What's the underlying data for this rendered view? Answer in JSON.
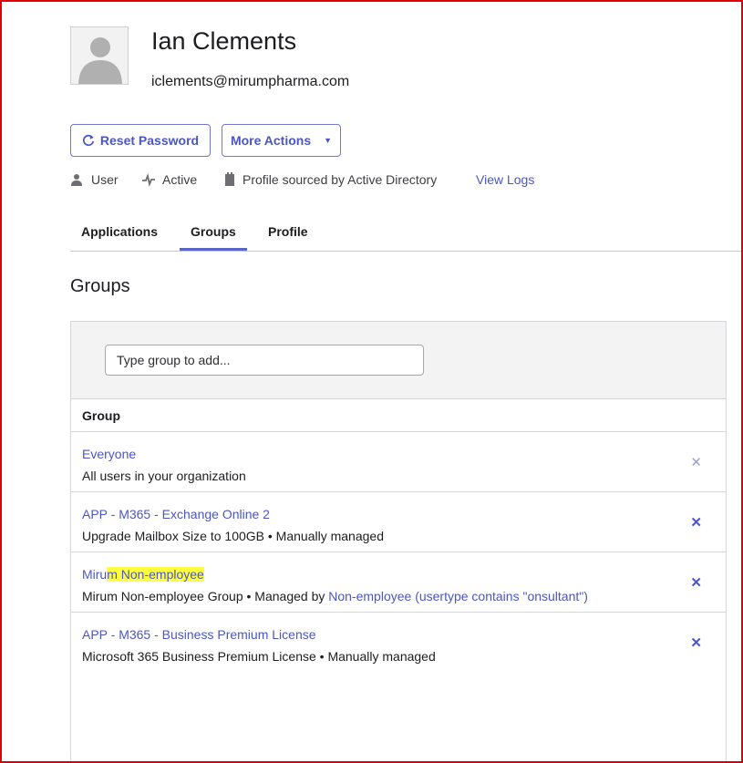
{
  "user": {
    "name": "Ian Clements",
    "email": "iclements@mirumpharma.com"
  },
  "actions": {
    "reset_password": "Reset Password",
    "more_actions": "More Actions"
  },
  "meta": {
    "user_type": "User",
    "status": "Active",
    "profile_source": "Profile sourced by Active Directory",
    "view_logs": "View Logs"
  },
  "tabs": [
    {
      "label": "Applications"
    },
    {
      "label": "Groups"
    },
    {
      "label": "Profile"
    }
  ],
  "active_tab": "Groups",
  "section_title": "Groups",
  "search": {
    "placeholder": "Type group to add..."
  },
  "table": {
    "column_header": "Group",
    "rows": [
      {
        "title": "Everyone",
        "description": "All users in your organization"
      },
      {
        "title": "APP - M365 - Exchange Online 2",
        "description": "Upgrade Mailbox Size to 100GB • Manually managed"
      },
      {
        "title_plain": "Miru",
        "title_highlight": "m Non-employee",
        "description_prefix": "Mirum Non-employee Group • Managed by ",
        "description_link": "Non-employee (usertype contains \"onsultant\")"
      },
      {
        "title": "APP - M365 - Business Premium License",
        "description": "Microsoft 365 Business Premium License • Manually managed"
      }
    ]
  },
  "colors": {
    "accent": "#4b56c4",
    "highlight": "#ffff40",
    "frame": "#e00000"
  },
  "icons": [
    "refresh-icon",
    "caret-down-icon",
    "user-icon",
    "activity-icon",
    "directory-icon",
    "close-icon"
  ]
}
